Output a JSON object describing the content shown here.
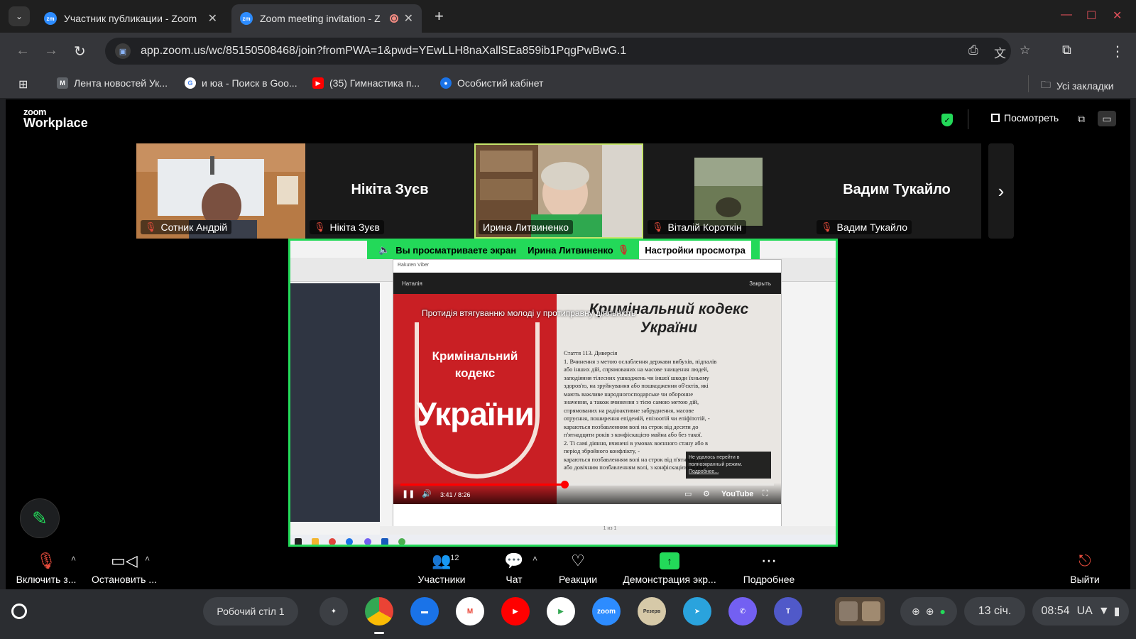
{
  "browser": {
    "tabs": [
      {
        "title": "Участник публикации - Zoom",
        "favicon": "zm",
        "active": false
      },
      {
        "title": "Zoom meeting invitation - Z",
        "favicon": "zm",
        "active": true,
        "recording": true
      }
    ],
    "url": "app.zoom.us/wc/85150508468/join?fromPWA=1&pwd=YEwLLH8naXallSEa859ib1PqgPwBwG.1",
    "bookmarks": [
      {
        "label": "Лента новостей Ук...",
        "icon": "M",
        "color": "#444444"
      },
      {
        "label": "и юа - Поиск в Goo...",
        "icon": "G",
        "color": "#ffffff"
      },
      {
        "label": "(35) Гимнастика п...",
        "icon": "▶",
        "color": "#ff0000"
      },
      {
        "label": "Особистий кабінет",
        "icon": "●",
        "color": "#1a73e8"
      }
    ],
    "all_bookmarks": "Усі закладки"
  },
  "zoom": {
    "logo_small": "zoom",
    "logo_big": "Workplace",
    "view_label": "Посмотреть",
    "participants": [
      {
        "name": "Сотник Андрій",
        "video": true,
        "muted": true
      },
      {
        "name": "Нікіта Зуєв",
        "video": false,
        "muted": true
      },
      {
        "name": "Ирина Литвиненко",
        "video": true,
        "muted": false,
        "speaking": true
      },
      {
        "name": "Віталій Короткін",
        "video": true,
        "muted": true
      },
      {
        "name": "Вадим Тукайло",
        "video": false,
        "muted": true
      }
    ],
    "share_banner": {
      "text": "Вы просматриваете экран",
      "presenter": "Ирина Литвиненко",
      "options": "Настройки просмотра"
    },
    "shared_screen": {
      "viber_title": "Rakuten Viber",
      "chat_name": "Наталія",
      "chat_close": "Закрыть",
      "video_title_overlay": "Протидія втягуванню молоді у протиправну діяльність",
      "left_line1": "Кримінальний",
      "left_line2": "кодекс",
      "left_big": "України",
      "right_title_1": "Кримінальний кодекс",
      "right_title_2": "України",
      "article_lines": [
        "Стаття 113. Диверсія",
        "1. Вчинення з метою ослаблення держави вибухів, підпалів",
        "або інших дій, спрямованих на масове знищення людей,",
        "заподіяння тілесних ушкоджень чи іншої шкоди їхньому",
        "здоров'ю, на зруйнування або пошкодження об'єктів, які",
        "мають важливе народногосподарське чи оборонне",
        "значення, а також вчинення з тією самою метою дій,",
        "спрямованих на радіоактивне забруднення, масове",
        "отруєння, поширення епідемій, епізоотій чи епіфітотій, -",
        "караються позбавленням волі на строк від десяти до",
        "п'ятнадцяти років з конфіскацією майна або без такої.",
        "2. Ті самі діяння, вчинені в умовах воєнного стану або в",
        "період збройного конфлікту, -",
        "караються позбавленням волі на строк від п'ятнадцяти",
        "або довічним позбавленням волі, з конфіскацією майна."
      ],
      "fullscreen_error": "Не удалось перейти в полноэкранный режим.",
      "fullscreen_more": "Подробнее...",
      "time": "3:41 / 8:26",
      "progress": 0.44,
      "youtube": "YouTube",
      "doc_pages": "1 из 1"
    },
    "controls": {
      "mic": "Включить з...",
      "video": "Остановить ...",
      "participants": "Участники",
      "participants_count": "12",
      "chat": "Чат",
      "reactions": "Реакции",
      "share": "Демонстрация экр...",
      "more": "Подробнее",
      "leave": "Выйти"
    }
  },
  "shelf": {
    "desk": "Робочий стіл 1",
    "apps": [
      {
        "name": "gemini",
        "color": "#3c3f44",
        "glyph": "✦"
      },
      {
        "name": "chrome",
        "color": "#4caf50",
        "glyph": ""
      },
      {
        "name": "files",
        "color": "#1a73e8",
        "glyph": "▬"
      },
      {
        "name": "gmail",
        "color": "#ffffff",
        "glyph": "M"
      },
      {
        "name": "youtube",
        "color": "#ff0000",
        "glyph": "▶"
      },
      {
        "name": "play",
        "color": "#ffffff",
        "glyph": "▶"
      },
      {
        "name": "zoom",
        "color": "#2d8cff",
        "glyph": "zoom"
      },
      {
        "name": "reserve",
        "color": "#d6c9a8",
        "glyph": "Резерв"
      },
      {
        "name": "telegram",
        "color": "#2aa3dd",
        "glyph": "➤"
      },
      {
        "name": "viber",
        "color": "#7360f2",
        "glyph": "✆"
      },
      {
        "name": "teams",
        "color": "#5059c9",
        "glyph": "T"
      }
    ],
    "date": "13 січ.",
    "time": "08:54",
    "lang": "UA"
  }
}
